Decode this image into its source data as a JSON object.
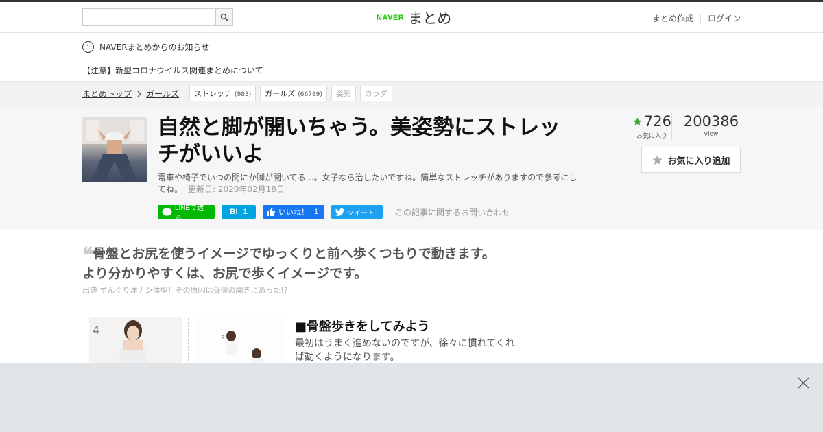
{
  "header": {
    "search_placeholder": "",
    "logo_brand": "NAVER",
    "logo_title": "まとめ",
    "nav": [
      "まとめ作成",
      "ログイン"
    ]
  },
  "notices": {
    "info_glyph": "i",
    "title": "NAVERまとめからのお知らせ",
    "item": "【注意】新型コロナウイルス関連まとめについて"
  },
  "breadcrumb": {
    "home": "まとめトップ",
    "category": "ガールズ",
    "tags": [
      {
        "label": "ストレッチ",
        "count": "(983)"
      },
      {
        "label": "ガールズ",
        "count": "(66789)"
      },
      {
        "label": "姿勢",
        "count": ""
      },
      {
        "label": "カラダ",
        "count": ""
      }
    ]
  },
  "article": {
    "title": "自然と脚が開いちゃう。美姿勢にストレッチがいいよ",
    "description": "電車や椅子でいつの間にか脚が開いてる…。女子なら治したいですね。簡単なストレッチがありますので参考にしてね。",
    "updated": "更新日: 2020年02月18日",
    "favorites": "726",
    "favorites_label": "お気に入り",
    "views": "200386",
    "views_label": "view",
    "fav_button": "お気に入り追加",
    "share": {
      "line": "LINEで送る",
      "hatena_logo": "B!",
      "hatena_count": "1",
      "fb_label": "いいね！",
      "fb_count": "1",
      "tweet": "ツイート"
    },
    "contact": "この記事に関するお問い合わせ"
  },
  "content": {
    "quote_mark": "❝",
    "quote": "骨盤とお尻を使うイメージでゆっくりと前へ歩くつもりで動きます。より分かりやすくは、お尻で歩くイメージです。",
    "source": "出典 ずんぐり洋ナシ体型！その原因は骨盤の開きにあった!?",
    "image_step_left": "4",
    "image_step_right": "2",
    "section_title": "■骨盤歩きをしてみよう",
    "section_body": "最初はうまく進めないのですが、徐々に慣れてくれば動くようになります。"
  },
  "colors": {
    "brand_green": "#1ec800",
    "line_green": "#00b900",
    "hatena_blue": "#00a4de",
    "fb_blue": "#1877f2",
    "tw_blue": "#1da1f2",
    "star_green": "#3aa53a",
    "ad_bg": "#e1e4e7"
  }
}
